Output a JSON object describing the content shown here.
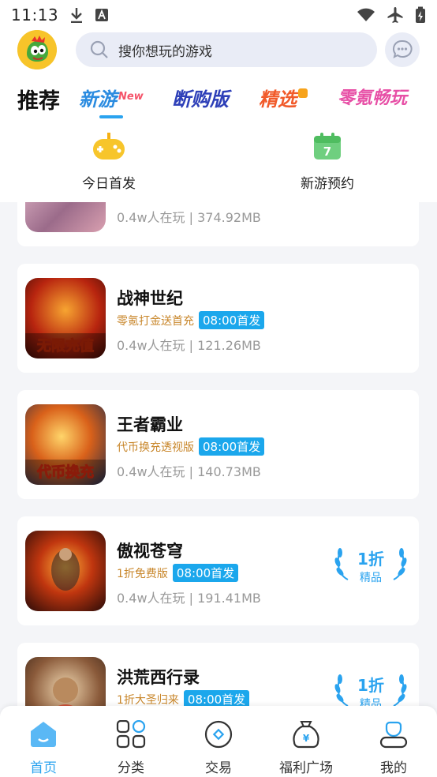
{
  "status": {
    "time": "11:13"
  },
  "search": {
    "placeholder": "搜你想玩的游戏"
  },
  "tabs": {
    "recommend": "推荐",
    "new_games": "新游",
    "new_games_sup": "New",
    "buyout": "断购版",
    "featured": "精选",
    "zero_play": "零氪畅玩"
  },
  "quick": {
    "today": "今日首发",
    "reserve": "新游预约",
    "reserve_day": "7"
  },
  "games": [
    {
      "name": "",
      "tag": "",
      "time": "",
      "meta": "0.4w人在玩 | 374.92MB"
    },
    {
      "name": "战神世纪",
      "tag": "零氪打金送首充",
      "time": "08:00首发",
      "meta": "0.4w人在玩 | 121.26MB",
      "thumb_text": "无限充值"
    },
    {
      "name": "王者霸业",
      "tag": "代币换充透视版",
      "time": "08:00首发",
      "meta": "0.4w人在玩 | 140.73MB",
      "thumb_text": "代币换充"
    },
    {
      "name": "傲视苍穹",
      "tag": "1折免费版",
      "time": "08:00首发",
      "meta": "0.4w人在玩 | 191.41MB",
      "badge_top": "1折",
      "badge_bottom": "精品"
    },
    {
      "name": "洪荒西行录",
      "tag": "1折大圣归来",
      "time": "08:00首发",
      "meta": "",
      "badge_top": "1折",
      "badge_bottom": "精品"
    }
  ],
  "nav": {
    "home": "首页",
    "category": "分类",
    "trade": "交易",
    "welfare": "福利广场",
    "mine": "我的"
  },
  "colors": {
    "accent": "#2aa3ef",
    "tag": "#c8862a",
    "time_badge": "#1ba7ec"
  }
}
